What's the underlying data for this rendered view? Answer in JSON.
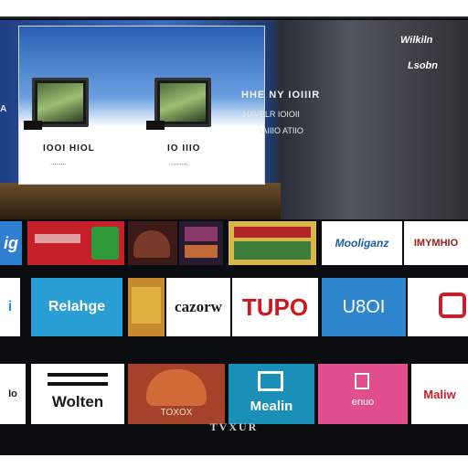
{
  "hero": {
    "edge_label": "A",
    "card": {
      "product1_name": "IOOI HIOL",
      "product1_sub": "........",
      "product2_name": "IO IIIO",
      "product2_sub": "........"
    },
    "title": "HHE NY IOIIIR",
    "line1": "HAVELR IOIOII",
    "line2": "IAIIIO ATIIO",
    "brand_a": "Wilkiln",
    "brand_b": "Lsobn"
  },
  "rows": [
    {
      "tiles": [
        {
          "label": "ig",
          "bg": "#2f7fd1",
          "fg": "#ffffff"
        },
        {
          "label": "",
          "bg": "#c71f2b",
          "fg": "#ffffff"
        },
        {
          "label": "",
          "bg": "#3b1a18",
          "fg": "#ffffff"
        },
        {
          "label": "",
          "bg": "#2a1a30",
          "fg": "#ffffff"
        },
        {
          "label": "",
          "bg": "#d8b64a",
          "fg": "#1a1a1a"
        },
        {
          "label": "Mooliganz",
          "bg": "#ffffff",
          "fg": "#1a5fa0"
        },
        {
          "label": "IMYMHIO",
          "bg": "#ffffff",
          "fg": "#9b1c1c"
        }
      ]
    },
    {
      "tiles": [
        {
          "label": "i",
          "bg": "#ffffff",
          "fg": "#2a8fd0"
        },
        {
          "label": "Relahge",
          "bg": "#2a9fd6",
          "fg": "#ffffff"
        },
        {
          "label": "",
          "bg": "#c88a2e",
          "fg": "#ffffff"
        },
        {
          "label": "cazorw",
          "bg": "#ffffff",
          "fg": "#1a1a1a"
        },
        {
          "label": "TUPO",
          "bg": "#ffffff",
          "fg": "#d0171f"
        },
        {
          "label": "U8OI",
          "bg": "#2f86cc",
          "fg": "#ffffff"
        },
        {
          "label": "",
          "bg": "#ffffff",
          "fg": "#c71f2b"
        }
      ]
    },
    {
      "tiles": [
        {
          "label": "Io",
          "bg": "#ffffff",
          "fg": "#1a1a1a"
        },
        {
          "label": "Wolten",
          "bg": "#ffffff",
          "fg": "#1a1a1a"
        },
        {
          "label": "TOXOX",
          "bg": "#a4432a",
          "fg": "#f0e0c0"
        },
        {
          "label": "Mealin",
          "bg": "#1a8fb8",
          "fg": "#ffffff"
        },
        {
          "label": "enuo",
          "bg": "#e24f8f",
          "fg": "#ffffff"
        },
        {
          "label": "Maliw",
          "bg": "#ffffff",
          "fg": "#c71f2b"
        }
      ]
    }
  ],
  "bottom_logo": "TVXUR"
}
